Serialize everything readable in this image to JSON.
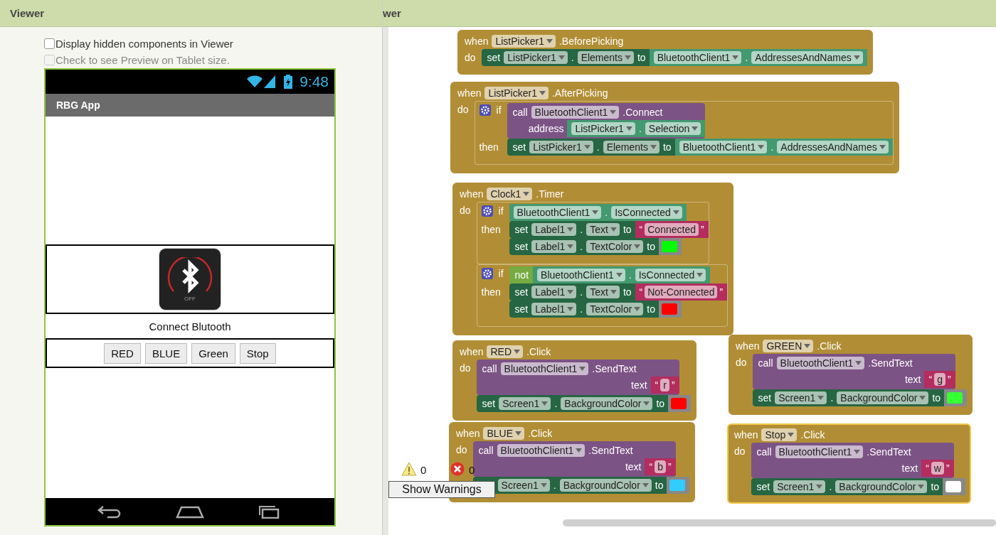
{
  "viewer": {
    "title": "Viewer",
    "options": [
      {
        "label": "Display hidden components in Viewer",
        "checked": false,
        "disabled": false
      },
      {
        "label": "Check to see Preview on Tablet size.",
        "checked": false,
        "disabled": true
      }
    ]
  },
  "phone": {
    "time": "9:48",
    "title": "RBG App",
    "image_caption": "OFF",
    "label": "Connect Blutooth",
    "buttons": [
      "RED",
      "BLUE",
      "Green",
      "Stop"
    ]
  },
  "blocks_panel": {
    "title": "wer",
    "blocks": [
      {
        "kind": "event",
        "when": "when",
        "component": "ListPicker1",
        "event": ".BeforePicking",
        "do": "do",
        "selected": false,
        "body": [
          {
            "kind": "set",
            "keyword": "set",
            "component": "ListPicker1",
            "dot": ".",
            "property": "Elements",
            "to": "to",
            "value": {
              "kind": "getter",
              "component": "BluetoothClient1",
              "dot": ".",
              "property": "AddressesAndNames"
            }
          }
        ]
      },
      {
        "kind": "event",
        "when": "when",
        "component": "ListPicker1",
        "event": ".AfterPicking",
        "do": "do",
        "selected": false,
        "body": [
          {
            "kind": "if",
            "keyword": "if",
            "condition": {
              "kind": "call",
              "keyword": "call",
              "component": "BluetoothClient1",
              "method": ".Connect",
              "arg_label": "address",
              "arg": {
                "kind": "getter",
                "component": "ListPicker1",
                "dot": ".",
                "property": "Selection"
              }
            },
            "then": "then",
            "body": [
              {
                "kind": "set",
                "keyword": "set",
                "component": "ListPicker1",
                "dot": ".",
                "property": "Elements",
                "to": "to",
                "value": {
                  "kind": "getter",
                  "component": "BluetoothClient1",
                  "dot": ".",
                  "property": "AddressesAndNames"
                }
              }
            ]
          }
        ]
      },
      {
        "kind": "event",
        "when": "when",
        "component": "Clock1",
        "event": ".Timer",
        "do": "do",
        "selected": false,
        "body": [
          {
            "kind": "if",
            "keyword": "if",
            "condition": {
              "kind": "getter",
              "component": "BluetoothClient1",
              "dot": ".",
              "property": "IsConnected"
            },
            "then": "then",
            "body": [
              {
                "kind": "set",
                "keyword": "set",
                "component": "Label1",
                "dot": ".",
                "property": "Text",
                "to": "to",
                "value": {
                  "kind": "text",
                  "open": "“",
                  "value": "Connected",
                  "close": "”"
                }
              },
              {
                "kind": "set",
                "keyword": "set",
                "component": "Label1",
                "dot": ".",
                "property": "TextColor",
                "to": "to",
                "value": {
                  "kind": "color",
                  "color": "#00ff00"
                }
              }
            ]
          },
          {
            "kind": "if",
            "keyword": "if",
            "condition": {
              "kind": "not",
              "keyword": "not",
              "operand": {
                "kind": "getter",
                "component": "BluetoothClient1",
                "dot": ".",
                "property": "IsConnected"
              }
            },
            "then": "then",
            "body": [
              {
                "kind": "set",
                "keyword": "set",
                "component": "Label1",
                "dot": ".",
                "property": "Text",
                "to": "to",
                "value": {
                  "kind": "text",
                  "open": "“",
                  "value": "Not-Connected",
                  "close": "”"
                }
              },
              {
                "kind": "set",
                "keyword": "set",
                "component": "Label1",
                "dot": ".",
                "property": "TextColor",
                "to": "to",
                "value": {
                  "kind": "color",
                  "color": "#ff0000"
                }
              }
            ]
          }
        ]
      },
      {
        "kind": "event",
        "when": "when",
        "component": "RED",
        "event": ".Click",
        "do": "do",
        "selected": false,
        "body": [
          {
            "kind": "call",
            "keyword": "call",
            "component": "BluetoothClient1",
            "method": ".SendText",
            "arg_label": "text",
            "arg": {
              "kind": "text",
              "open": "“",
              "value": "r",
              "close": "”"
            }
          },
          {
            "kind": "set",
            "keyword": "set",
            "component": "Screen1",
            "dot": ".",
            "property": "BackgroundColor",
            "to": "to",
            "value": {
              "kind": "color",
              "color": "#ff0000"
            }
          }
        ]
      },
      {
        "kind": "event",
        "when": "when",
        "component": "BLUE",
        "event": ".Click",
        "do": "do",
        "selected": false,
        "body": [
          {
            "kind": "call",
            "keyword": "call",
            "component": "BluetoothClient1",
            "method": ".SendText",
            "arg_label": "text",
            "arg": {
              "kind": "text",
              "open": "“",
              "value": "b",
              "close": "”"
            }
          },
          {
            "kind": "set",
            "component": "Screen1",
            "dot": ".",
            "property": "BackgroundColor",
            "to": "to",
            "value": {
              "kind": "color",
              "color": "#33ccff"
            }
          }
        ]
      },
      {
        "kind": "event",
        "when": "when",
        "component": "GREEN",
        "event": ".Click",
        "do": "do",
        "selected": false,
        "body": [
          {
            "kind": "call",
            "keyword": "call",
            "component": "BluetoothClient1",
            "method": ".SendText",
            "arg_label": "text",
            "arg": {
              "kind": "text",
              "open": "“",
              "value": "g",
              "close": "”"
            }
          },
          {
            "kind": "set",
            "keyword": "set",
            "component": "Screen1",
            "dot": ".",
            "property": "BackgroundColor",
            "to": "to",
            "value": {
              "kind": "color",
              "color": "#33ff33"
            }
          }
        ]
      },
      {
        "kind": "event",
        "when": "when",
        "component": "Stop",
        "event": ".Click",
        "do": "do",
        "selected": true,
        "body": [
          {
            "kind": "call",
            "keyword": "call",
            "component": "BluetoothClient1",
            "method": ".SendText",
            "arg_label": "text",
            "arg": {
              "kind": "text",
              "open": "“",
              "value": "w",
              "close": "”"
            }
          },
          {
            "kind": "set",
            "keyword": "set",
            "component": "Screen1",
            "dot": ".",
            "property": "BackgroundColor",
            "to": "to",
            "value": {
              "kind": "color",
              "color": "#ffffff"
            }
          }
        ]
      }
    ],
    "warnings": {
      "warning_count": "0",
      "error_count": "0",
      "button": "Show Warnings"
    }
  }
}
